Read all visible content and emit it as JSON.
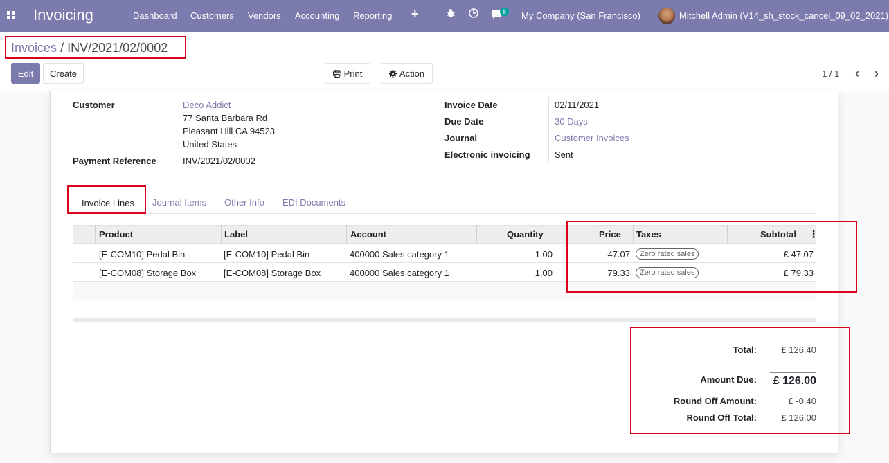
{
  "navbar": {
    "app_title": "Invoicing",
    "menus": [
      "Dashboard",
      "Customers",
      "Vendors",
      "Accounting",
      "Reporting"
    ],
    "plus_icon": "+",
    "bug_icon": "bug-icon",
    "clock_icon": "clock-icon",
    "chat_count": "8",
    "company": "My Company (San Francisco)",
    "user": "Mitchell Admin (V14_sh_stock_cancel_09_02_2021)"
  },
  "breadcrumb": {
    "parent": "Invoices",
    "separator": "/",
    "current": "INV/2021/02/0002"
  },
  "buttons": {
    "edit": "Edit",
    "create": "Create",
    "print": "Print",
    "action": "Action"
  },
  "pager": {
    "value": "1 / 1"
  },
  "invoice": {
    "customer_label": "Customer",
    "customer_name": "Deco Addict",
    "address_1": "77 Santa Barbara Rd",
    "address_2": "Pleasant Hill CA 94523",
    "address_3": "United States",
    "payment_ref_label": "Payment Reference",
    "payment_ref": "INV/2021/02/0002",
    "invoice_date_label": "Invoice Date",
    "invoice_date": "02/11/2021",
    "due_date_label": "Due Date",
    "due_date": "30 Days",
    "journal_label": "Journal",
    "journal": "Customer Invoices",
    "edi_label": "Electronic invoicing",
    "edi": "Sent"
  },
  "tabs": [
    "Invoice Lines",
    "Journal Items",
    "Other Info",
    "EDI Documents"
  ],
  "lines": {
    "headers": [
      "Product",
      "Label",
      "Account",
      "Quantity",
      "Price",
      "Taxes",
      "Subtotal"
    ],
    "rows": [
      {
        "product": "[E-COM10] Pedal Bin",
        "label": "[E-COM10] Pedal Bin",
        "account": "400000 Sales category 1",
        "quantity": "1.00",
        "price": "47.07",
        "tax": "Zero rated sales",
        "subtotal": "£ 47.07"
      },
      {
        "product": "[E-COM08] Storage Box",
        "label": "[E-COM08] Storage Box",
        "account": "400000 Sales category 1",
        "quantity": "1.00",
        "price": "79.33",
        "tax": "Zero rated sales",
        "subtotal": "£ 79.33"
      }
    ]
  },
  "totals": {
    "total_label": "Total:",
    "total": "£ 126.40",
    "amount_due_label": "Amount Due:",
    "amount_due": "£ 126.00",
    "round_off_label": "Round Off Amount:",
    "round_off": "£ -0.40",
    "round_off_total_label": "Round Off Total:",
    "round_off_total": "£ 126.00"
  },
  "colors": {
    "brand": "#7c7bad",
    "highlight": "#d9001b",
    "badge": "#00a09d"
  }
}
